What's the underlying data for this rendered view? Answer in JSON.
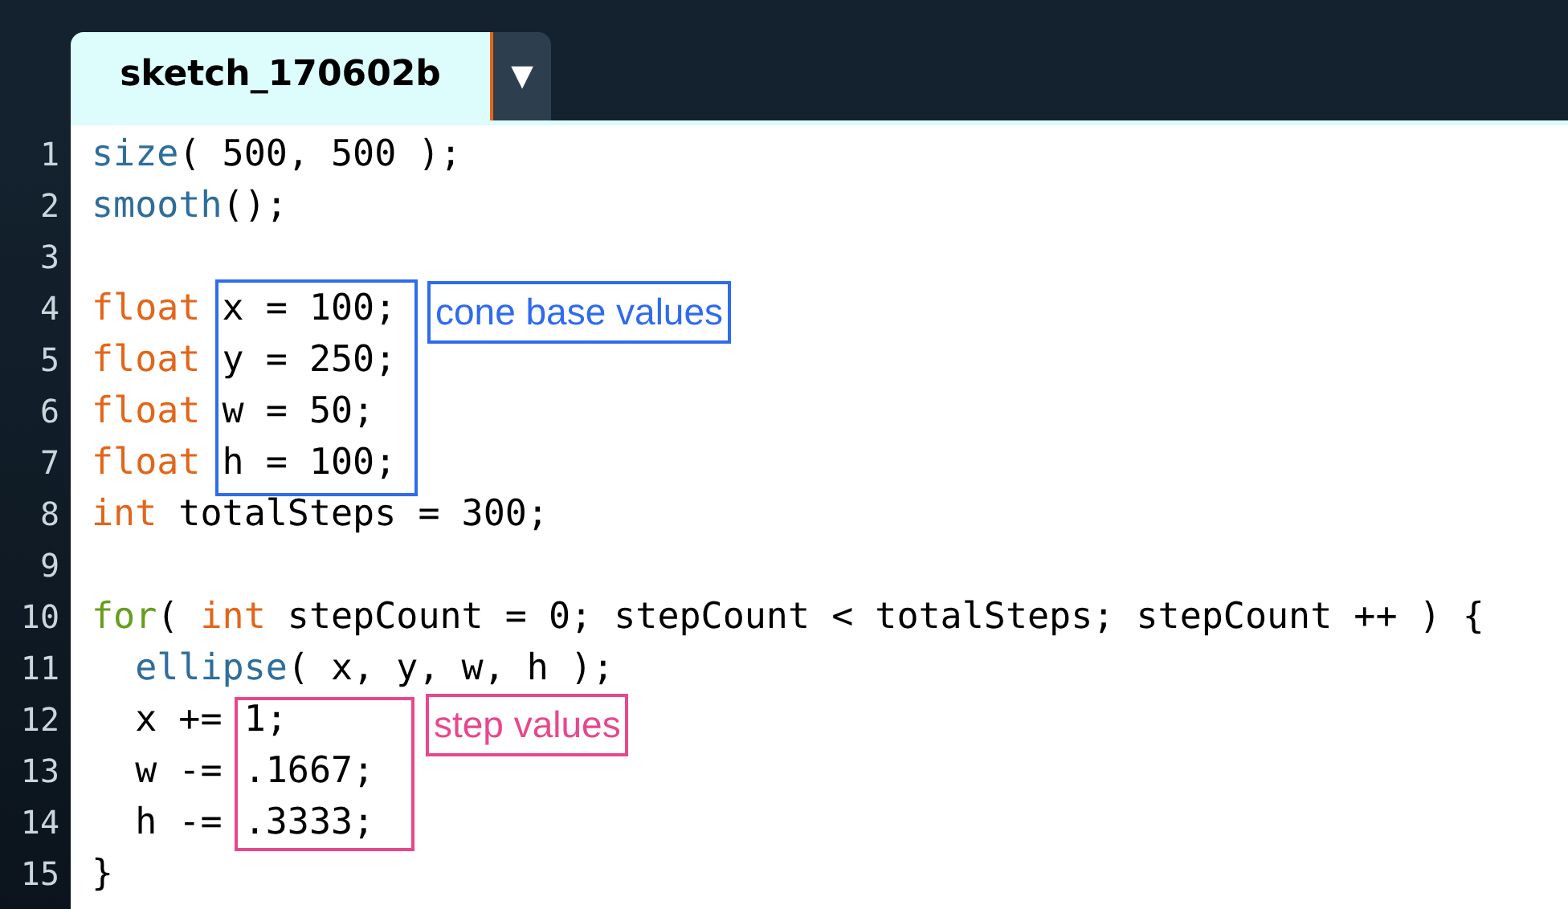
{
  "tab": {
    "title": "sketch_170602b",
    "selected": true
  },
  "tab_menu": {
    "label": "▼"
  },
  "lines": [
    {
      "number": "1",
      "tokens": [
        {
          "kind": "function",
          "text": "size"
        },
        {
          "kind": "plain",
          "text": "( 500, 500 );"
        }
      ]
    },
    {
      "number": "2",
      "tokens": [
        {
          "kind": "function",
          "text": "smooth"
        },
        {
          "kind": "plain",
          "text": "();"
        }
      ]
    },
    {
      "number": "3"
    },
    {
      "number": "4",
      "tokens": [
        {
          "kind": "type",
          "text": "float"
        },
        {
          "kind": "plain",
          "text": " x = 100;"
        }
      ]
    },
    {
      "number": "5",
      "tokens": [
        {
          "kind": "type",
          "text": "float"
        },
        {
          "kind": "plain",
          "text": " y = 250;"
        }
      ]
    },
    {
      "number": "6",
      "tokens": [
        {
          "kind": "type",
          "text": "float"
        },
        {
          "kind": "plain",
          "text": " w = 50;"
        }
      ]
    },
    {
      "number": "7",
      "tokens": [
        {
          "kind": "type",
          "text": "float"
        },
        {
          "kind": "plain",
          "text": " h = 100;"
        }
      ]
    },
    {
      "number": "8",
      "tokens": [
        {
          "kind": "type",
          "text": "int"
        },
        {
          "kind": "plain",
          "text": " totalSteps = 300;"
        }
      ]
    },
    {
      "number": "9"
    },
    {
      "number": "10",
      "tokens": [
        {
          "kind": "control",
          "text": "for"
        },
        {
          "kind": "plain",
          "text": "( "
        },
        {
          "kind": "type",
          "text": "int"
        },
        {
          "kind": "plain",
          "text": " stepCount = 0; stepCount < totalSteps; stepCount ++ ) {"
        }
      ]
    },
    {
      "number": "11",
      "tokens": [
        {
          "kind": "function",
          "text": "  ellipse"
        },
        {
          "kind": "plain",
          "text": "( x, y, w, h );"
        }
      ]
    },
    {
      "number": "12",
      "tokens": [
        {
          "kind": "plain",
          "text": "  x += 1;"
        }
      ]
    },
    {
      "number": "13",
      "tokens": [
        {
          "kind": "plain",
          "text": "  w -= .1667;"
        }
      ]
    },
    {
      "number": "14",
      "tokens": [
        {
          "kind": "plain",
          "text": "  h -= .3333;"
        }
      ]
    },
    {
      "number": "15",
      "tokens": [
        {
          "kind": "plain",
          "text": "}"
        }
      ]
    }
  ],
  "annotations": [
    {
      "label": "cone base values",
      "color": "#2f6bef"
    },
    {
      "label": "step values",
      "color": "#e8478e"
    }
  ]
}
